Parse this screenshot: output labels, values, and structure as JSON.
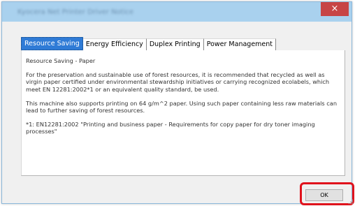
{
  "window": {
    "title": "Kyocera Net Printer Driver Notice",
    "close_glyph": "×"
  },
  "tabs": [
    {
      "label": "Resource Saving",
      "active": true
    },
    {
      "label": "Energy Efficiency",
      "active": false
    },
    {
      "label": "Duplex Printing",
      "active": false
    },
    {
      "label": "Power Management",
      "active": false
    }
  ],
  "content": {
    "heading": "Resource Saving - Paper",
    "paragraph1": "For the preservation and sustainable use of forest resources, it is recommended that recycled as well as virgin paper certified under environmental stewardship initiatives or carrying  recognized ecolabels, which meet EN 12281:2002*1 or an equivalent quality standard, be used.",
    "paragraph2": "This machine also supports printing on 64 g/m^2 paper.  Using such paper containing less raw materials can lead to further saving of forest resources.",
    "footnote": "*1: EN12281:2002 \"Printing and business paper - Requirements for copy paper for dry toner imaging processes\""
  },
  "buttons": {
    "ok_label": "OK"
  },
  "colors": {
    "titlebar": "#a9d1ee",
    "close": "#c74545",
    "active_tab": "#2f7bd6",
    "highlight": "#e0121c"
  },
  "icons": {
    "close": "close-icon",
    "grip": "resize-grip-icon"
  }
}
